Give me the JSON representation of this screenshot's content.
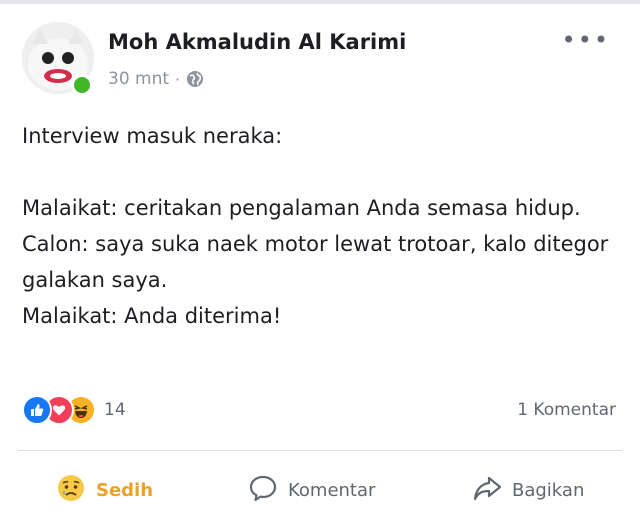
{
  "post": {
    "author": "Moh Akmaludin Al Karimi",
    "time": "30 mnt",
    "separator": "·",
    "privacy_icon": "globe-icon",
    "more_icon": "more-options-icon",
    "more_label": "•••",
    "lines": [
      "Interview masuk neraka:",
      "",
      "Malaikat: ceritakan pengalaman Anda semasa hidup.",
      "Calon: saya suka naek motor lewat trotoar, kalo ditegor galakan saya.",
      "Malaikat: Anda diterima!"
    ]
  },
  "reactions": {
    "icons": [
      "like-icon",
      "love-icon",
      "haha-icon"
    ],
    "count": "14",
    "comments": "1 Komentar"
  },
  "actions": {
    "reaction": "Sedih",
    "comment": "Komentar",
    "share": "Bagikan"
  },
  "colors": {
    "online": "#42b72a",
    "like": "#1877f2",
    "love": "#f33e58",
    "haha": "#f7b125",
    "sad": "#e9a126",
    "muted": "#606770"
  }
}
